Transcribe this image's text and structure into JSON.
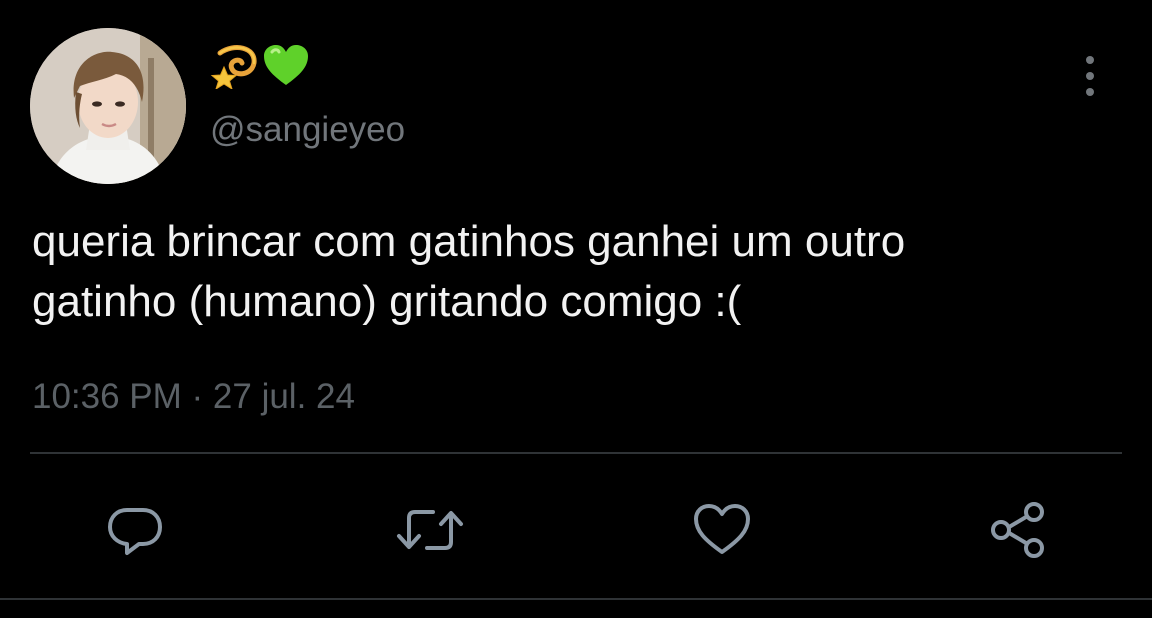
{
  "tweet": {
    "display_name_emojis": [
      "dizzy-emoji",
      "green-heart-emoji"
    ],
    "handle": "@sangieyeo",
    "text_lines": [
      "queria brincar com gatinhos ganhei um outro",
      "gatinho (humano) gritando comigo :("
    ],
    "timestamp": "10:36 PM · 27 jul. 24"
  },
  "actions": [
    {
      "name": "reply",
      "icon": "speech-bubble-icon"
    },
    {
      "name": "retweet",
      "icon": "retweet-arrows-icon"
    },
    {
      "name": "like",
      "icon": "heart-outline-icon"
    },
    {
      "name": "share",
      "icon": "share-nodes-icon"
    }
  ],
  "colors": {
    "background": "#000000",
    "text": "#f2f2f2",
    "secondary": "#71767b",
    "divider": "#2f3336",
    "icon": "#8b98a5"
  }
}
